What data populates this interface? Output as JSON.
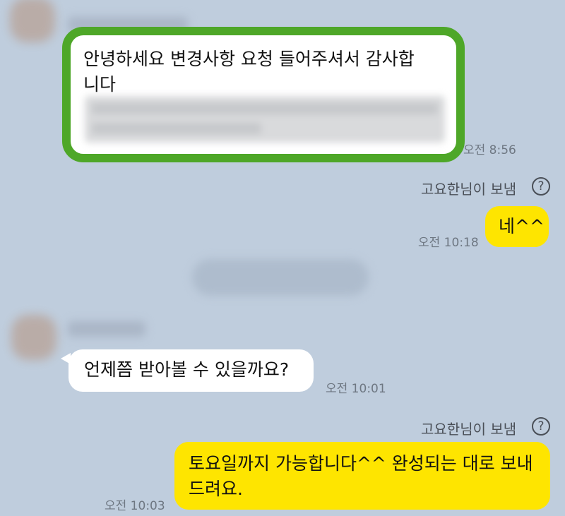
{
  "messages": [
    {
      "id": "m1",
      "direction": "incoming",
      "highlighted": true,
      "text_line1": "안녕하세요 변경사항 요청 들어주셔서 감사합",
      "text_line2": "니다",
      "time": "오전 8:56"
    },
    {
      "id": "m2",
      "direction": "outgoing",
      "sender_note": "고요한님이 보냄",
      "text": "네^^",
      "time": "오전 10:18"
    },
    {
      "id": "m3",
      "direction": "incoming",
      "text": "언제쯤 받아볼 수 있을까요?",
      "time": "오전 10:01"
    },
    {
      "id": "m4",
      "direction": "outgoing",
      "sender_note": "고요한님이 보냄",
      "text_line1": "토요일까지 가능합니다^^ 완성되는 대로 보내",
      "text_line2": "드려요.",
      "time": "오전 10:03"
    }
  ],
  "icons": {
    "help": "question-circle-icon",
    "help_glyph": "?"
  },
  "colors": {
    "background": "#bfcddd",
    "incoming_bubble": "#ffffff",
    "outgoing_bubble": "#fee500",
    "highlight_border": "#4ea728"
  }
}
